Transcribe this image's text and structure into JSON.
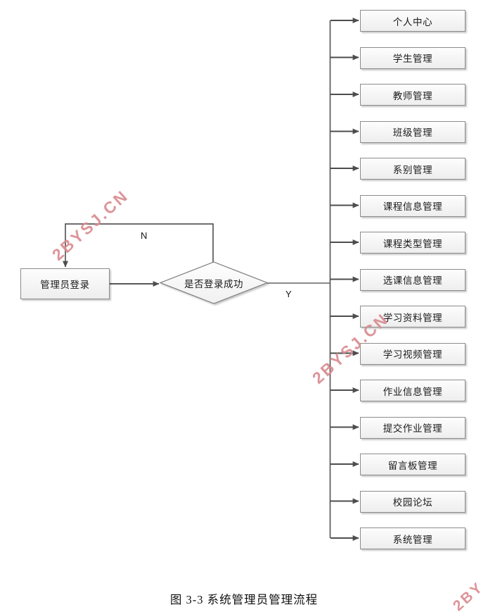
{
  "diagram": {
    "caption": "图 3-3  系统管理员管理流程",
    "start": {
      "label": "管理员登录"
    },
    "decision": {
      "label": "是否登录成功"
    },
    "edge_labels": {
      "no": "N",
      "yes": "Y"
    },
    "menu_items": [
      {
        "label": "个人中心"
      },
      {
        "label": "学生管理"
      },
      {
        "label": "教师管理"
      },
      {
        "label": "班级管理"
      },
      {
        "label": "系别管理"
      },
      {
        "label": "课程信息管理"
      },
      {
        "label": "课程类型管理"
      },
      {
        "label": "选课信息管理"
      },
      {
        "label": "学习资料管理"
      },
      {
        "label": "学习视频管理"
      },
      {
        "label": "作业信息管理"
      },
      {
        "label": "提交作业管理"
      },
      {
        "label": "留言板管理"
      },
      {
        "label": "校园论坛"
      },
      {
        "label": "系统管理"
      }
    ],
    "colors": {
      "line": "#595959",
      "node_border": "#8c8c8c",
      "node_fill": "#f6f6f6",
      "watermark": "#d98a8f",
      "text": "#1a1a1a"
    }
  },
  "watermarks": [
    {
      "text": "2BYSJ.CN"
    },
    {
      "text": "2BYSJ.CN"
    },
    {
      "text": "2BY"
    }
  ]
}
